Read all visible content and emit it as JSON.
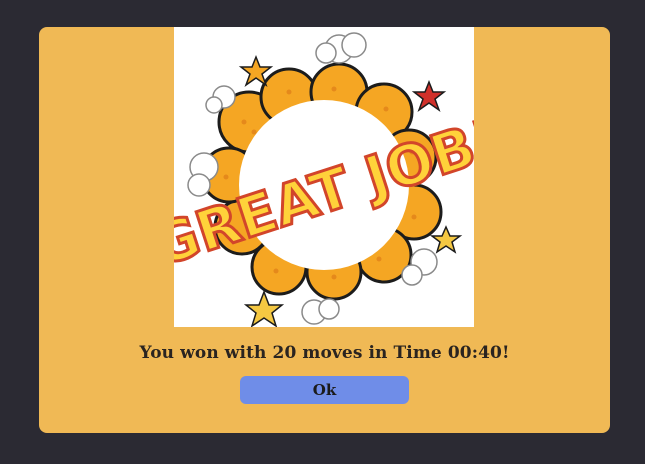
{
  "dialog": {
    "illustration": {
      "text": "GREAT JOB!",
      "icon": "comic-explosion-illustration"
    },
    "message": "You won with 20 moves in Time 00:40!",
    "ok_label": "Ok"
  },
  "colors": {
    "page_background": "#2b2a33",
    "dialog_background": "#f0b955",
    "button_background": "#6f8de8",
    "burst_fill": "#f5a623",
    "lettering_fill": "#ffd23a",
    "lettering_outline": "#d2452a"
  }
}
